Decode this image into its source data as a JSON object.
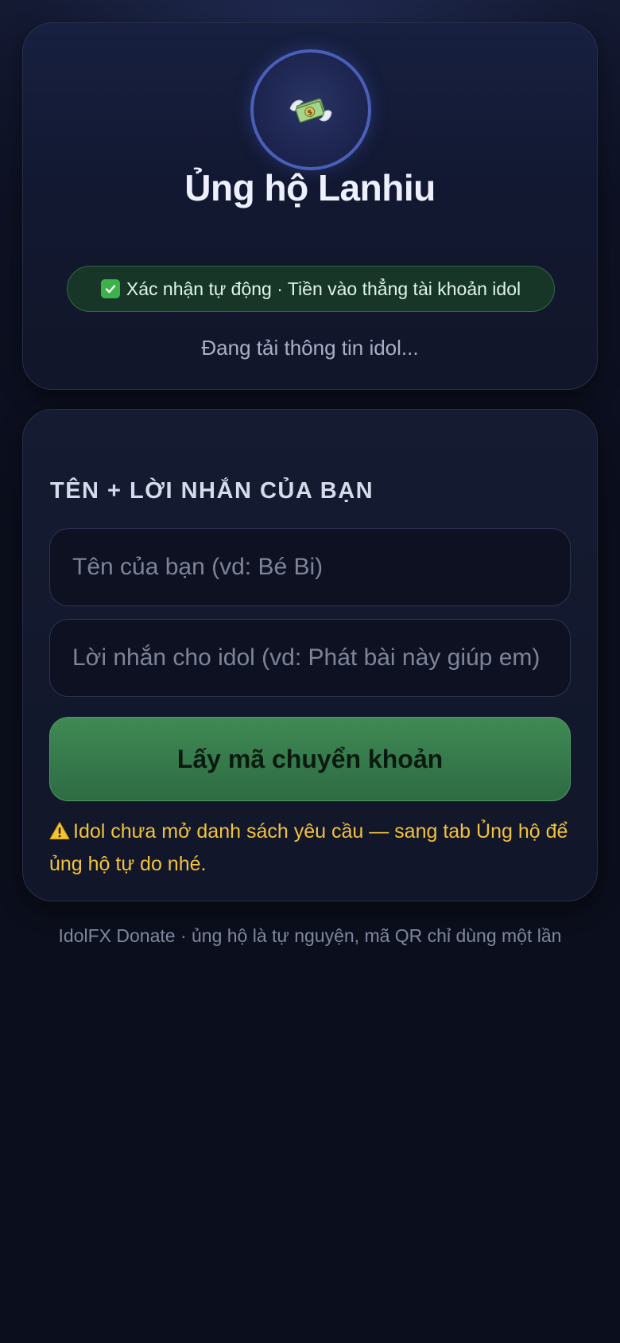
{
  "header": {
    "avatar_icon": "money-with-wings-icon",
    "title": "Ủng hộ Lanhiu",
    "badge_icon": "check-mark-button-icon",
    "badge_text": "Xác nhận tự động · Tiền vào thẳng tài khoản idol",
    "loading_text": "Đang tải thông tin idol..."
  },
  "form": {
    "section_label": "TÊN + LỜI NHẮN CỦA BẠN",
    "name_placeholder": "Tên của bạn (vd: Bé Bi)",
    "message_placeholder": "Lời nhắn cho idol (vd: Phát bài này giúp em)",
    "submit_label": "Lấy mã chuyển khoản",
    "warning_icon": "warning-icon",
    "warning_text": "Idol chưa mở danh sách yêu cầu — sang tab Ủng hộ để ủng hộ tự do nhé."
  },
  "footer": {
    "text": "IdolFX Donate · ủng hộ là tự nguyện, mã QR chỉ dùng một lần"
  },
  "colors": {
    "accent_green": "#3f8a55",
    "warning_yellow": "#f2c23c",
    "avatar_ring": "#4a5fb8"
  }
}
